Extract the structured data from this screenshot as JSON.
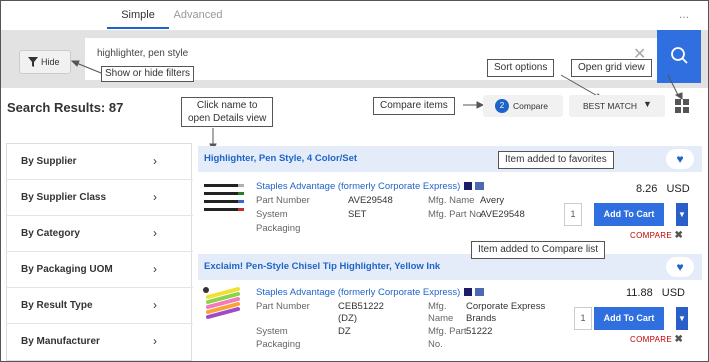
{
  "tabs": [
    {
      "label": "Simple"
    },
    {
      "label": "Advanced"
    }
  ],
  "more_label": "...",
  "search": {
    "value": "highlighter, pen style",
    "clear_icon": "close-icon",
    "button_icon": "search-icon"
  },
  "filters": {
    "hide_label": "Hide"
  },
  "results": {
    "title": "Search Results: 87"
  },
  "compare": {
    "count": "2",
    "label": "Compare"
  },
  "sort": {
    "selected": "BEST MATCH"
  },
  "annotations": {
    "show_hide": "Show or hide filters",
    "click_name_1": "Click name to",
    "click_name_2": "open Details view",
    "compare_items": "Compare items",
    "sort_options": "Sort options",
    "grid_view": "Open grid view",
    "favorites": "Item added to favorites",
    "compare_list": "Item added to Compare list"
  },
  "sidebar": {
    "items": [
      {
        "label": "By Supplier"
      },
      {
        "label": "By Supplier Class"
      },
      {
        "label": "By Category"
      },
      {
        "label": "By Packaging UOM"
      },
      {
        "label": "By Result Type"
      },
      {
        "label": "By Manufacturer"
      }
    ]
  },
  "products": [
    {
      "heading": "Highlighter, Pen Style, 4 Color/Set",
      "supplier": "Staples Advantage (formerly Corporate Express)",
      "part_number_label": "Part Number",
      "part_number": "AVE29548",
      "mfg_name_label": "Mfg. Name",
      "mfg_name": "Avery",
      "system_label": "System",
      "system_value": "SET",
      "mfg_part_label": "Mfg. Part No.",
      "mfg_part": "AVE29548",
      "packaging_label": "Packaging",
      "price": "8.26",
      "currency": "USD",
      "qty": "1",
      "add_label": "Add To Cart",
      "compare_label": "COMPARE",
      "favorited": true
    },
    {
      "heading": "Exclaim! Pen-Style Chisel Tip Highlighter, Yellow Ink",
      "supplier": "Staples Advantage (formerly Corporate Express)",
      "part_number_label": "Part Number",
      "part_number_1": "CEB51222",
      "part_number_2": "(DZ)",
      "mfg_name_label_1": "Mfg.",
      "mfg_name_label_2": "Name",
      "mfg_name_1": "Corporate Express",
      "mfg_name_2": "Brands",
      "system_label": "System",
      "system_value": "DZ",
      "mfg_part_label_1": "Mfg. Part",
      "mfg_part_label_2": "No.",
      "mfg_part": "51222",
      "packaging_label": "Packaging",
      "price": "11.88",
      "currency": "USD",
      "qty": "1",
      "add_label": "Add To Cart",
      "compare_label": "COMPARE",
      "favorited": true
    }
  ]
}
